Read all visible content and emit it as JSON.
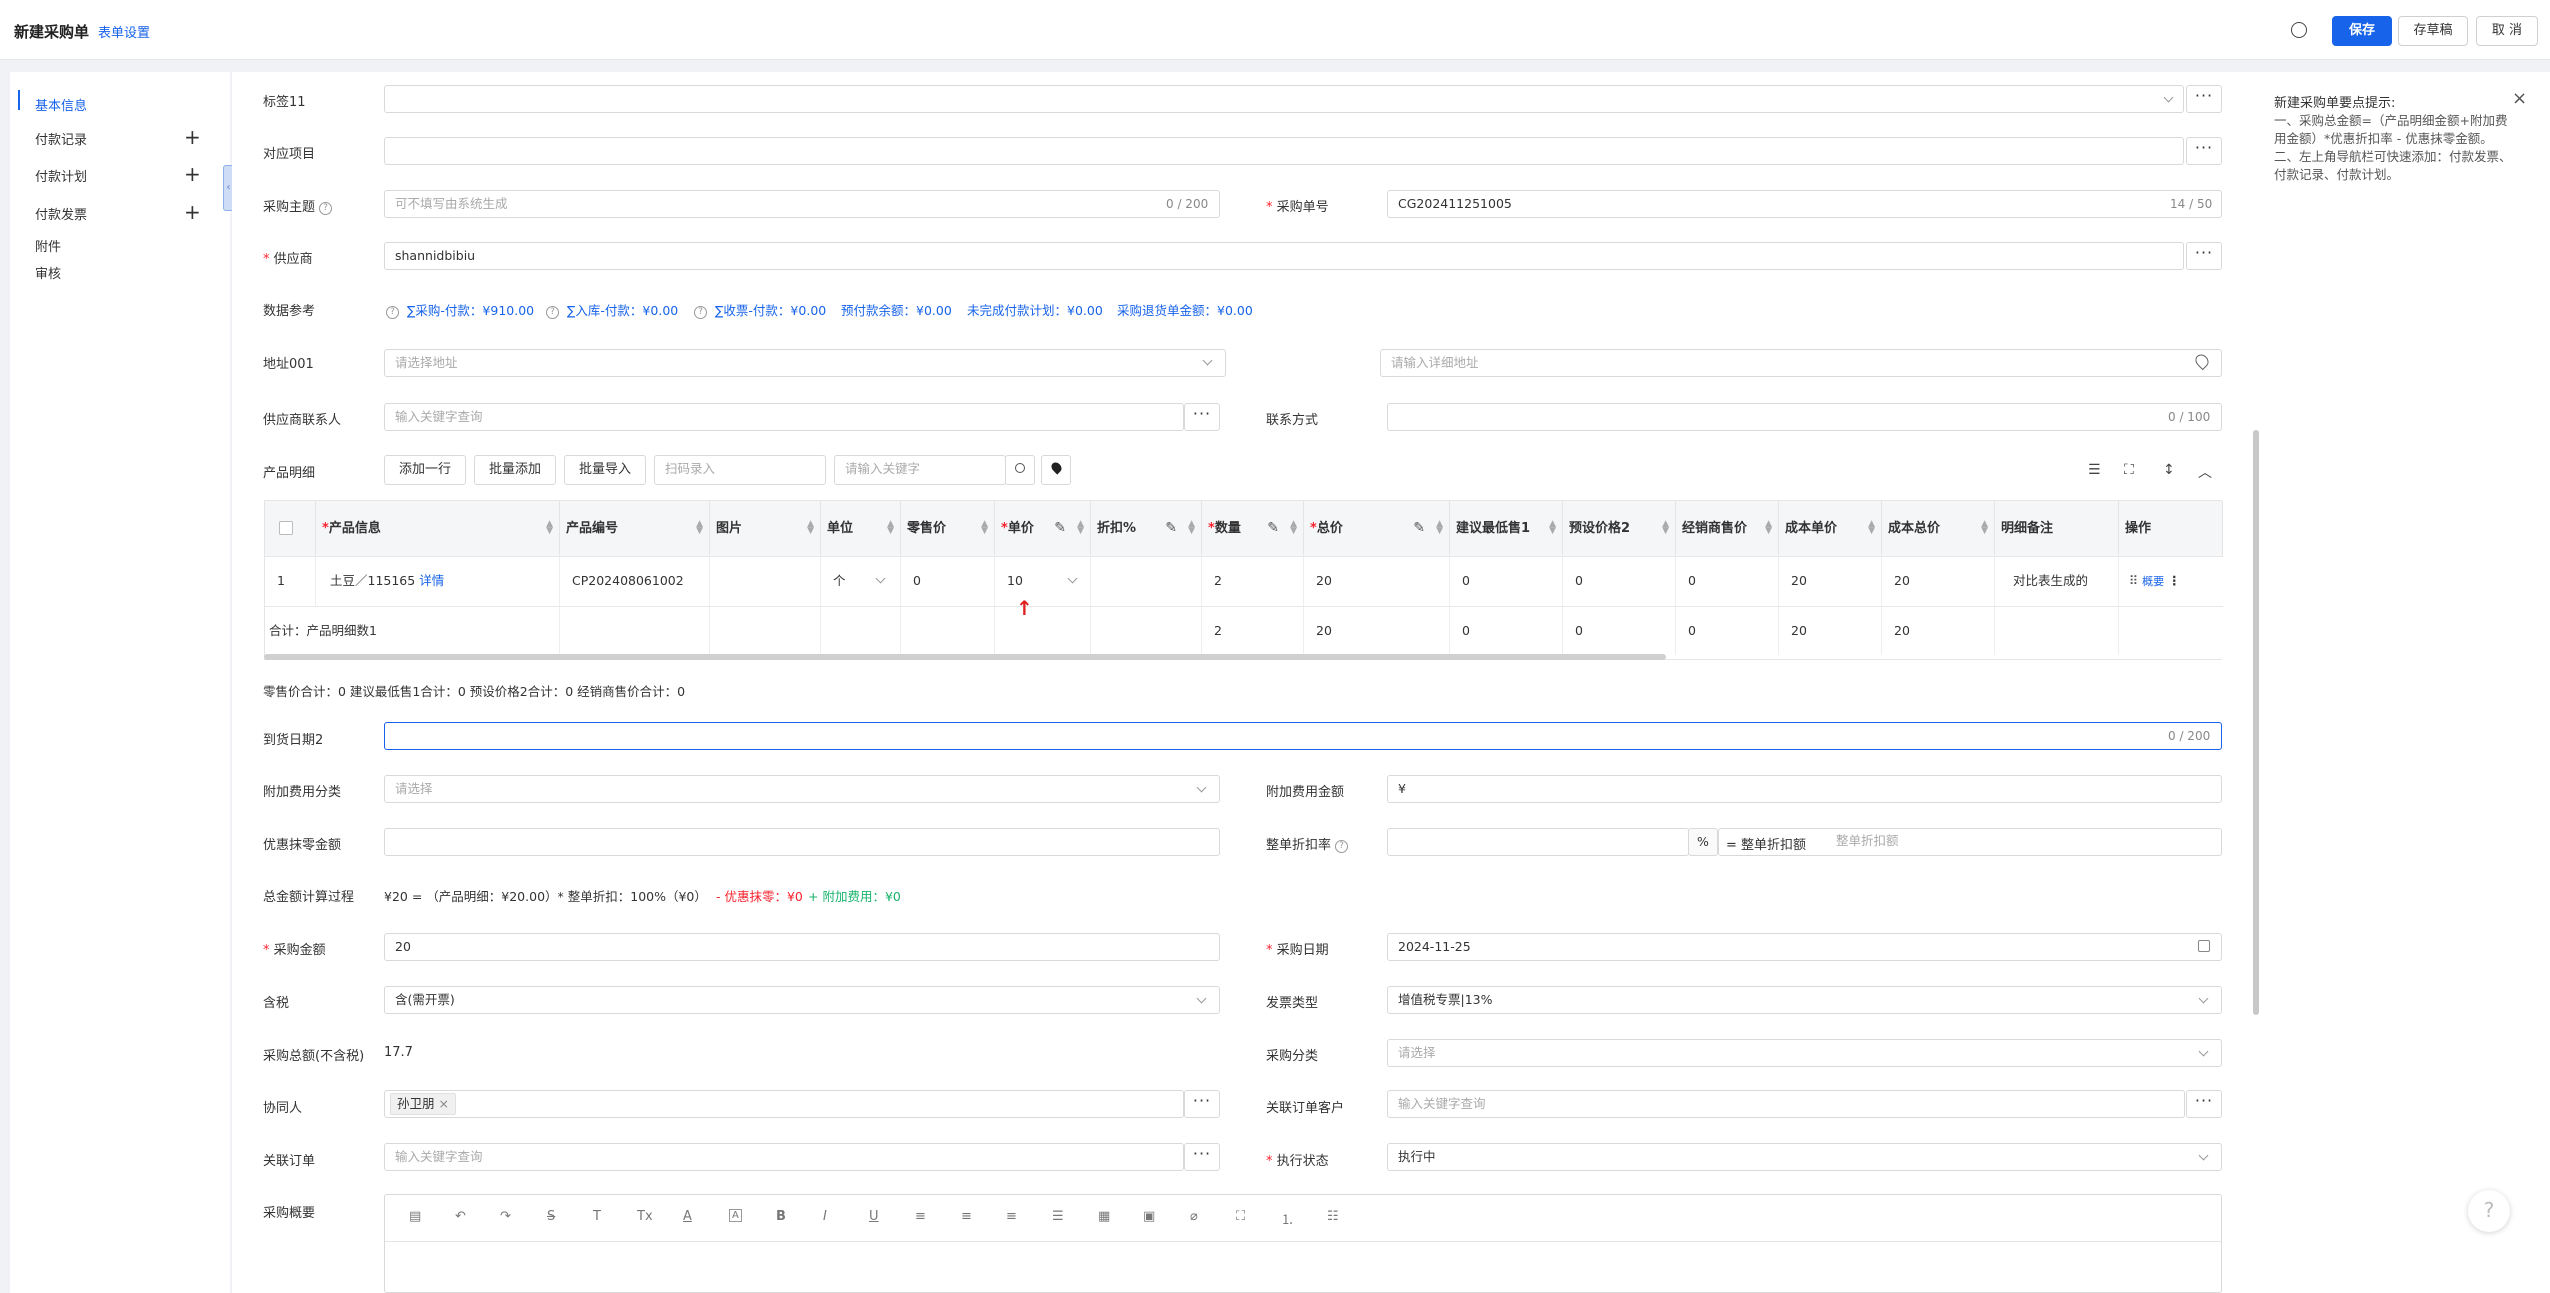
{
  "header": {
    "title": "新建采购单",
    "form_settings": "表单设置",
    "save": "保存",
    "draft": "存草稿",
    "cancel": "取 消"
  },
  "nav": {
    "items": [
      {
        "label": "基本信息",
        "active": true
      },
      {
        "label": "付款记录"
      },
      {
        "label": "付款计划"
      },
      {
        "label": "付款发票"
      },
      {
        "label": "附件"
      },
      {
        "label": "审核"
      }
    ],
    "plus": "+"
  },
  "tips": {
    "title": "新建采购单要点提示:",
    "lines": [
      "一、采购总金额=（产品明细金额+附加费",
      "用金额）*优惠折扣率 - 优惠抹零金额。",
      "二、左上角导航栏可快速添加：付款发票、",
      "付款记录、付款计划。"
    ],
    "close": "×"
  },
  "form": {
    "tag11": {
      "label": "标签11",
      "value": ""
    },
    "project": {
      "label": "对应项目",
      "value": ""
    },
    "subject": {
      "label": "采购主题",
      "placeholder": "可不填写由系统生成",
      "count": "0 / 200"
    },
    "order_no": {
      "label": "采购单号",
      "value": "CG202411251005",
      "count": "14 / 50"
    },
    "supplier": {
      "label": "供应商",
      "value": "shannidbibiu"
    },
    "data_ref": {
      "label": "数据参考",
      "items": [
        "∑采购-付款：¥910.00",
        "∑入库-付款：¥0.00",
        "∑收票-付款：¥0.00",
        "预付款余额：¥0.00",
        "未完成付款计划：¥0.00",
        "采购退货单金额：¥0.00"
      ]
    },
    "address": {
      "label": "地址001",
      "select_placeholder": "请选择地址",
      "detail_placeholder": "请输入详细地址"
    },
    "contact": {
      "label": "供应商联系人",
      "placeholder": "输入关键字查询"
    },
    "contact_method": {
      "label": "联系方式",
      "count": "0 / 100"
    },
    "product_detail": {
      "label": "产品明细",
      "add_row": "添加一行",
      "batch_add": "批量添加",
      "batch_import": "批量导入",
      "scan_placeholder": "扫码录入",
      "keyword_placeholder": "请输入关键字"
    },
    "table": {
      "columns": [
        "产品信息",
        "产品编号",
        "图片",
        "单位",
        "零售价",
        "单价",
        "折扣%",
        "数量",
        "总价",
        "建议最低售1",
        "预设价格2",
        "经销商售价",
        "成本单价",
        "成本总价",
        "明细备注",
        "操作"
      ],
      "rows": [
        {
          "no": "1",
          "product": "土豆／115165",
          "detail_link": "详情",
          "code": "CP202408061002",
          "image": "",
          "unit": "个",
          "retail": "0",
          "price": "10",
          "discount": "",
          "qty": "2",
          "total": "20",
          "min1": "0",
          "preset2": "0",
          "dealer": "0",
          "cost_unit": "20",
          "cost_total": "20",
          "remark": "对比表生成的",
          "op_label": "概要"
        }
      ],
      "sum_row": {
        "label": "合计：产品明细数1",
        "qty": "2",
        "total": "20",
        "min1": "0",
        "preset2": "0",
        "dealer": "0",
        "cost_unit": "20",
        "cost_total": "20"
      }
    },
    "sum_line": "零售价合计：0  建议最低售1合计：0  预设价格2合计：0  经销商售价合计：0",
    "arrival": {
      "label": "到货日期2",
      "count": "0 / 200"
    },
    "extra_fee_type": {
      "label": "附加费用分类",
      "placeholder": "请选择"
    },
    "extra_fee_amount": {
      "label": "附加费用金额",
      "value": "¥"
    },
    "discount_round": {
      "label": "优惠抹零金额",
      "value": ""
    },
    "discount_rate": {
      "label": "整单折扣率",
      "unit": "%",
      "equals": "= 整单折扣额",
      "placeholder": "整单折扣额"
    },
    "calc": {
      "label": "总金额计算过程",
      "part1": "¥20 = （产品明细：¥20.00）* 整单折扣：100%（¥0）",
      "part2": "- 优惠抹零：¥0",
      "part3": "+ 附加费用：¥0"
    },
    "amount": {
      "label": "采购金额",
      "value": "20"
    },
    "date": {
      "label": "采购日期",
      "value": "2024-11-25"
    },
    "tax": {
      "label": "含税",
      "value": "含(需开票)"
    },
    "invoice_type": {
      "label": "发票类型",
      "value": "增值税专票|13%"
    },
    "total_ex_tax": {
      "label": "采购总额(不含税)",
      "value": "17.7"
    },
    "category": {
      "label": "采购分类",
      "placeholder": "请选择"
    },
    "collaborator": {
      "label": "协同人",
      "tag": "孙卫朋"
    },
    "linked_customer": {
      "label": "关联订单客户",
      "placeholder": "输入关键字查询"
    },
    "linked_order": {
      "label": "关联订单",
      "placeholder": "输入关键字查询"
    },
    "exec_status": {
      "label": "执行状态",
      "value": "执行中"
    },
    "summary": {
      "label": "采购概要"
    }
  },
  "colors": {
    "primary": "#1763e9",
    "required": "#f5222d",
    "discount_red": "#f5222d",
    "fee_green": "#19b36b"
  }
}
